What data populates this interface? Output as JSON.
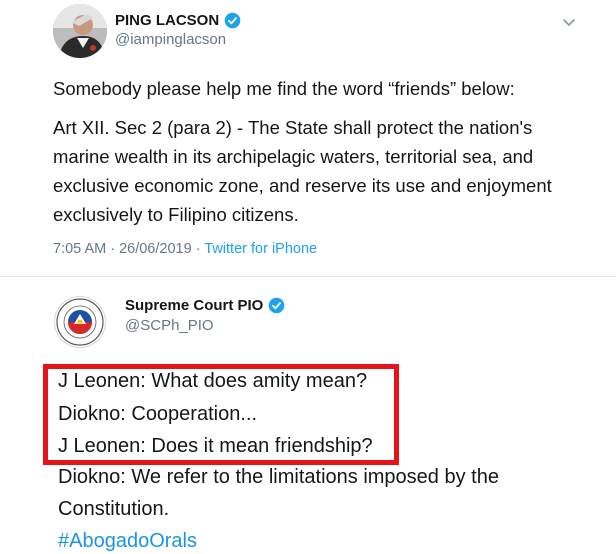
{
  "tweet1": {
    "name": "PING LACSON",
    "handle": "@iampinglacson",
    "lines": [
      "Somebody please help me find the word “friends” below:",
      "Art XII. Sec 2 (para 2) - The State shall protect the nation's",
      "marine wealth in its archipelagic waters, territorial sea, and",
      "exclusive economic zone, and reserve its use and enjoyment",
      "exclusively to Filipino citizens."
    ],
    "timestamp": "7:05 AM · 26/06/2019 · ",
    "source": "Twitter for iPhone"
  },
  "tweet2": {
    "name": "Supreme Court PIO",
    "handle": "@SCPh_PIO",
    "lines": [
      "J Leonen: What does amity mean?",
      "Diokno: Cooperation...",
      "J Leonen: Does it mean friendship?",
      "Diokno: We refer to the limitations imposed by the",
      "Constitution."
    ],
    "hashtag": "#AbogadoOrals"
  },
  "colors": {
    "verified_blue": "#1da1f2",
    "highlight_red": "#e8121b",
    "link_blue": "#1b95e0"
  },
  "icons": [
    "verified-badge-icon",
    "chevron-down-icon",
    "supreme-court-seal-icon"
  ]
}
